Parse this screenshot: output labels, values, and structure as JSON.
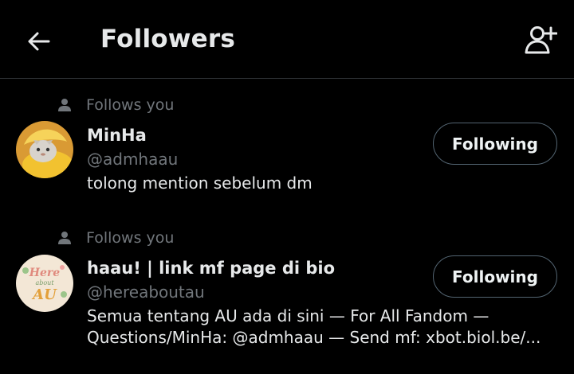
{
  "header": {
    "title": "Followers"
  },
  "followers": [
    {
      "follows_label": "Follows you",
      "name": "MinHa",
      "handle": "@admhaau",
      "bio_lines": [
        "tolong mention sebelum dm"
      ],
      "button_label": "Following"
    },
    {
      "follows_label": "Follows you",
      "name": "haau! | link mf page di bio",
      "handle": "@hereaboutau",
      "bio_lines": [
        "Semua tentang AU ada di sini — For All Fandom —",
        "Questions/MinHa: @admhaau — Send mf:  xbot.biol.be/..."
      ],
      "button_label": "Following",
      "avatar_text": [
        "Here",
        "about",
        "AU"
      ]
    }
  ],
  "colors": {
    "background": "#000000",
    "text_primary": "#e7e9ea",
    "text_secondary": "#71767b",
    "divider": "#2f3336",
    "button_border": "#536471"
  }
}
